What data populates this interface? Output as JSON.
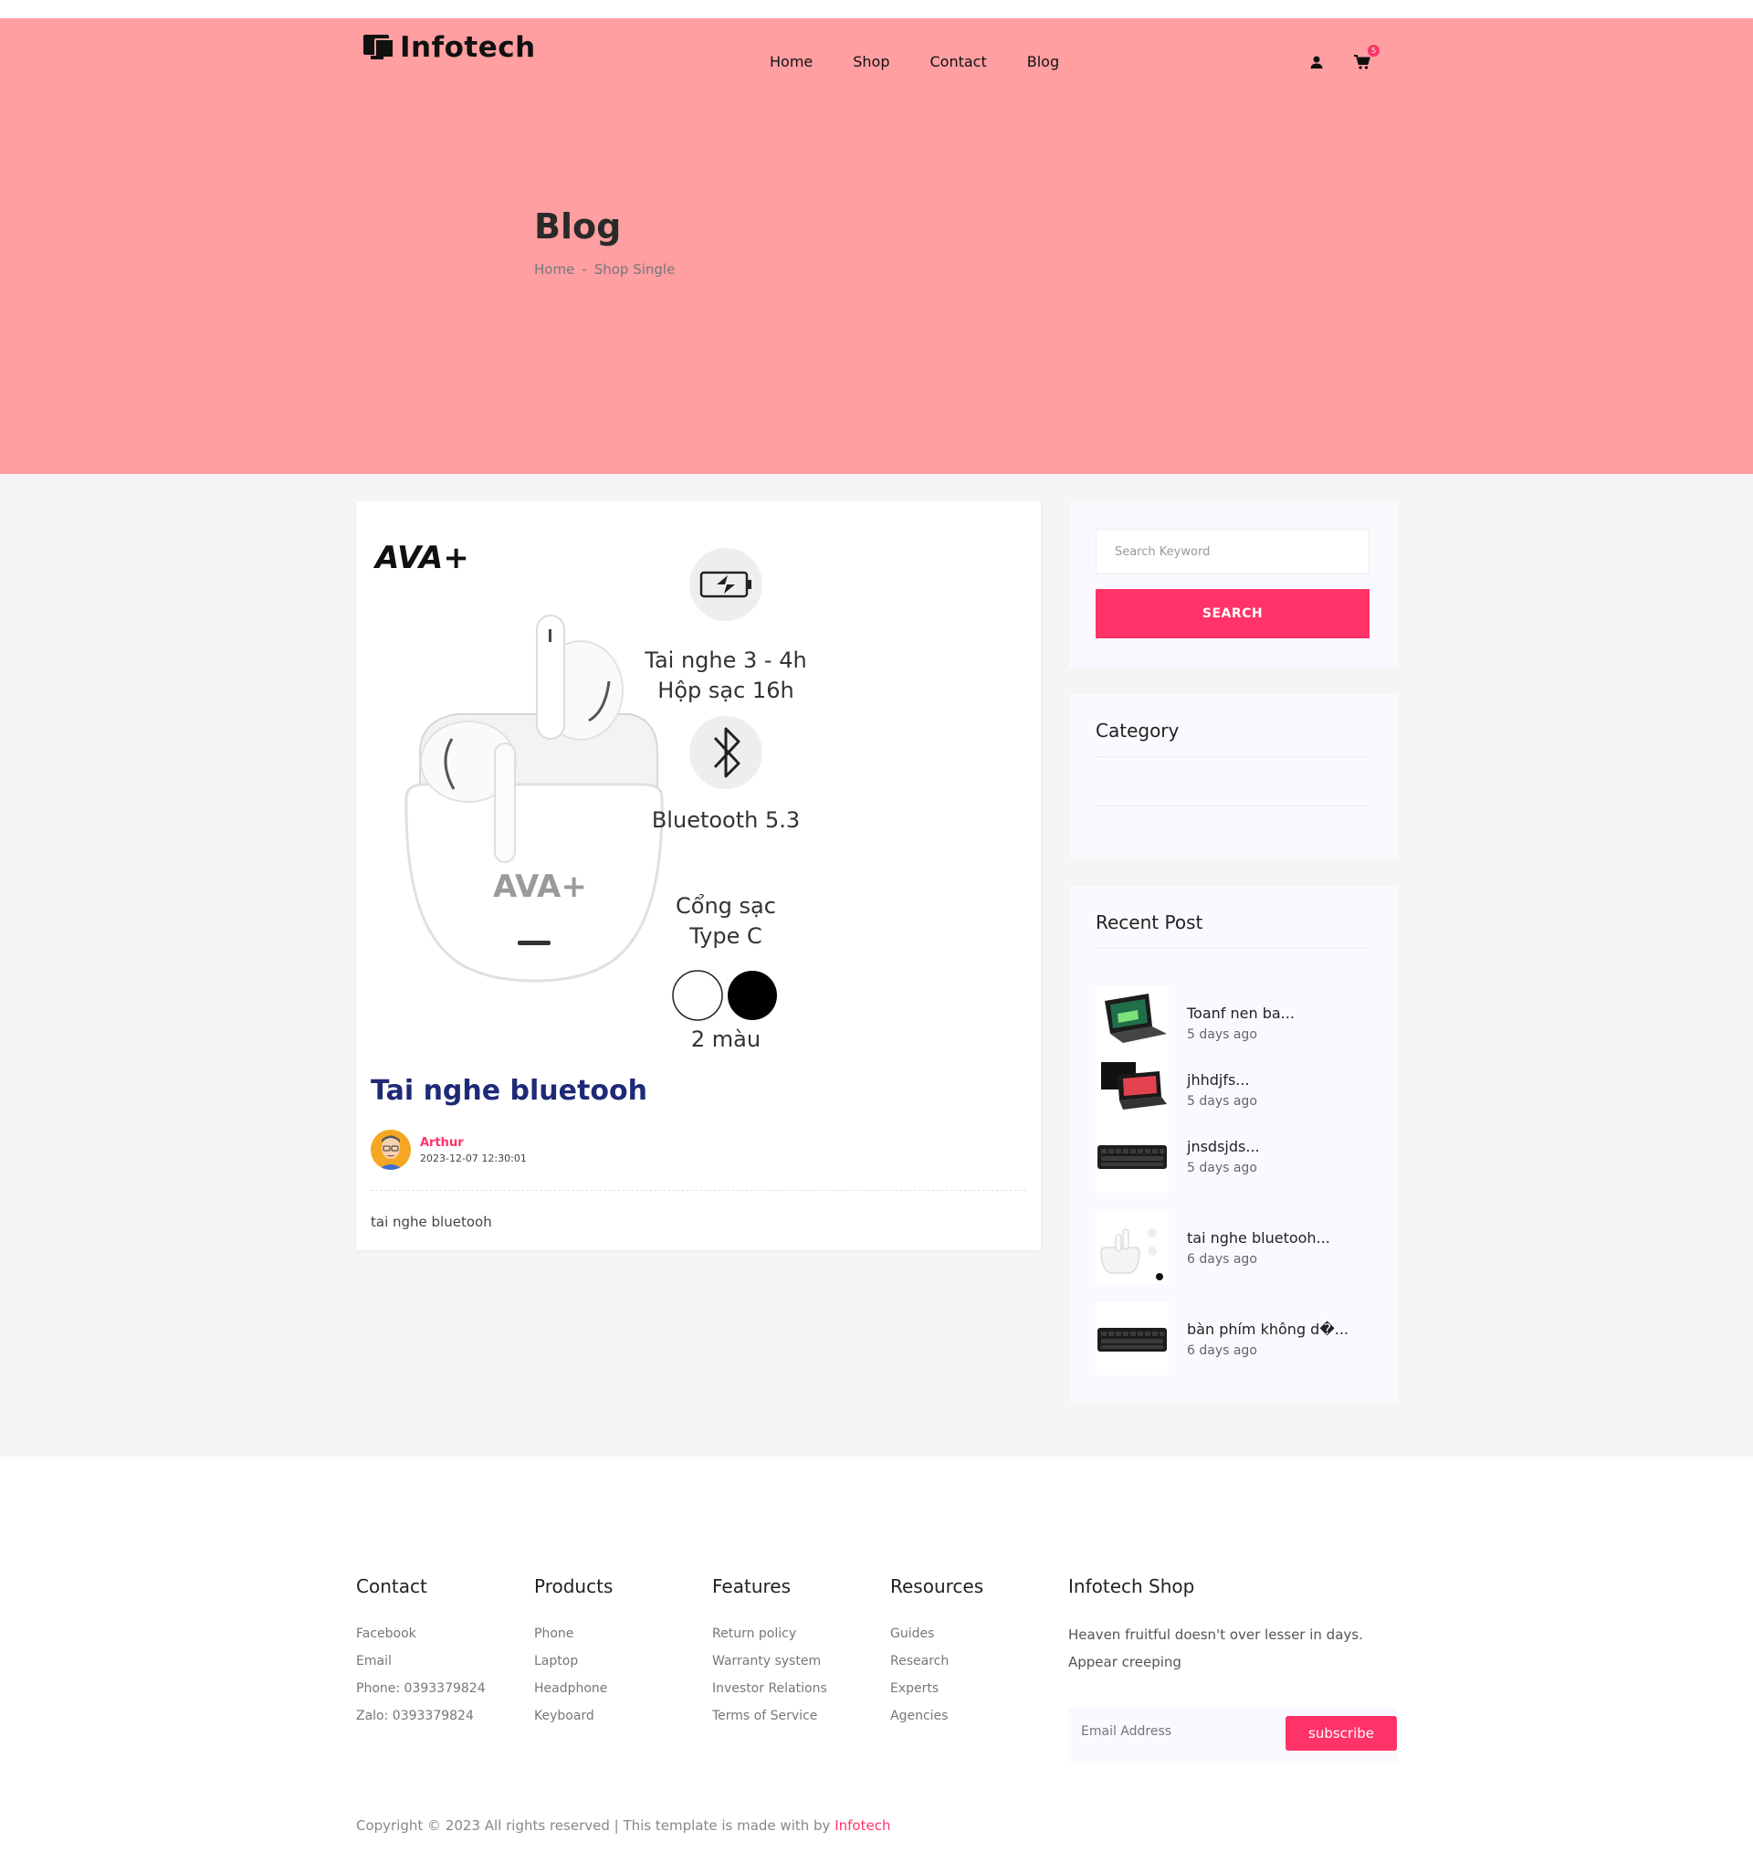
{
  "header": {
    "logo_text": "Infotech",
    "nav": [
      "Home",
      "Shop",
      "Contact",
      "Blog"
    ],
    "cart_count": "5"
  },
  "hero": {
    "title": "Blog",
    "breadcrumb": [
      "Home",
      "-",
      "Shop Single"
    ]
  },
  "post": {
    "image": {
      "brand": "AVA+",
      "features": [
        {
          "icon": "battery-icon",
          "line1": "Tai nghe 3 - 4h",
          "line2": "Hộp sạc 16h"
        },
        {
          "icon": "bluetooth-icon",
          "line1": "Bluetooth 5.3",
          "line2": ""
        },
        {
          "icon": "",
          "line1": "Cổng sạc",
          "line2": "Type C"
        },
        {
          "icon": "color-swatches",
          "line1": "2 màu",
          "line2": ""
        }
      ]
    },
    "title": "Tai nghe bluetooh",
    "author": "Arthur",
    "date": "2023-12-07 12:30:01",
    "body": "tai nghe bluetooh"
  },
  "sidebar": {
    "search_placeholder": "Search Keyword",
    "search_button": "SEARCH",
    "category_title": "Category",
    "recent_title": "Recent Post",
    "recent_posts": [
      {
        "title": "Toanf nen ba...",
        "time": "5 days ago",
        "thumb": "laptop-green"
      },
      {
        "title": "jhhdjfs...",
        "time": "5 days ago",
        "thumb": "laptop-red"
      },
      {
        "title": "jnsdsjds...",
        "time": "5 days ago",
        "thumb": "keyboard"
      },
      {
        "title": "tai nghe bluetooh...",
        "time": "6 days ago",
        "thumb": "earbuds"
      },
      {
        "title": "bàn phím không d�...",
        "time": "6 days ago",
        "thumb": "keyboard"
      }
    ]
  },
  "footer": {
    "columns": [
      {
        "title": "Contact",
        "links": [
          "Facebook",
          "Email",
          "Phone: 0393379824",
          "Zalo: 0393379824"
        ]
      },
      {
        "title": "Products",
        "links": [
          "Phone",
          "Laptop",
          "Headphone",
          "Keyboard"
        ]
      },
      {
        "title": "Features",
        "links": [
          "Return policy",
          "Warranty system",
          "Investor Relations",
          "Terms of Service"
        ]
      },
      {
        "title": "Resources",
        "links": [
          "Guides",
          "Research",
          "Experts",
          "Agencies"
        ]
      }
    ],
    "shop_title": "Infotech Shop",
    "shop_desc": "Heaven fruitful doesn't over lesser in days. Appear creeping",
    "email_placeholder": "Email Address",
    "subscribe": "subscribe",
    "copyright": "Copyright © 2023 All rights reserved | This template is made with by",
    "copyright_brand": "Infotech"
  },
  "colors": {
    "hero_bg": "#ff9fa2",
    "accent": "#ff3368",
    "post_title": "#1e2a78"
  }
}
